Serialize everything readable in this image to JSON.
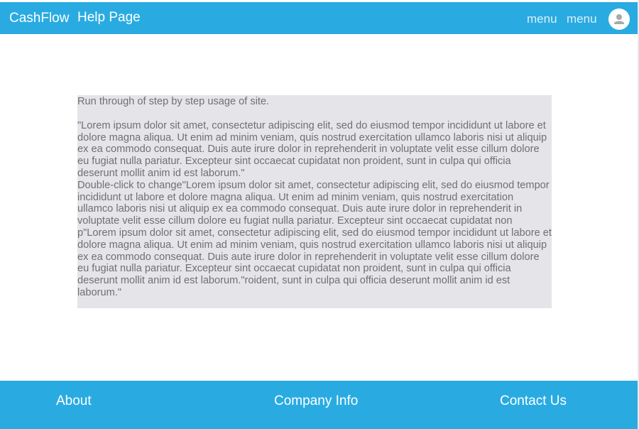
{
  "header": {
    "brand": "CashFlow",
    "title": "Help Page",
    "menu_items": [
      "menu",
      "menu"
    ],
    "avatar_icon": "user-avatar-icon",
    "background_color": "#29abe2"
  },
  "content": {
    "intro": "Run through of step by step usage of site.",
    "paragraph_1": "\"Lorem ipsum dolor sit amet, consectetur adipiscing elit, sed do eiusmod tempor incididunt ut labore et dolore magna aliqua. Ut enim ad minim veniam, quis nostrud exercitation ullamco laboris nisi ut aliquip ex ea commodo consequat. Duis aute irure dolor in reprehenderit in voluptate velit esse cillum dolore eu fugiat nulla pariatur. Excepteur sint occaecat cupidatat non proident, sunt in culpa qui officia deserunt mollit anim id est laborum.\"",
    "paragraph_2": "Double-click to change\"Lorem ipsum dolor sit amet, consectetur adipiscing elit, sed do eiusmod tempor incididunt ut labore et dolore magna aliqua. Ut enim ad minim veniam, quis nostrud exercitation ullamco laboris nisi ut aliquip ex ea commodo consequat. Duis aute irure dolor in reprehenderit in voluptate velit esse cillum dolore eu fugiat nulla pariatur. Excepteur sint occaecat cupidatat non p\"Lorem ipsum dolor sit amet, consectetur adipiscing elit, sed do eiusmod tempor incididunt ut labore et dolore magna aliqua. Ut enim ad minim veniam, quis nostrud exercitation ullamco laboris nisi ut aliquip ex ea commodo consequat. Duis aute irure dolor in reprehenderit in voluptate velit esse cillum dolore eu fugiat nulla pariatur. Excepteur sint occaecat cupidatat non proident, sunt in culpa qui officia deserunt mollit anim id est laborum.\"roident, sunt in culpa qui officia deserunt mollit anim id est laborum.\"",
    "background_color": "#e5e4e9"
  },
  "footer": {
    "links": [
      "About",
      "Company Info",
      "Contact Us"
    ],
    "background_color": "#29abe2"
  }
}
